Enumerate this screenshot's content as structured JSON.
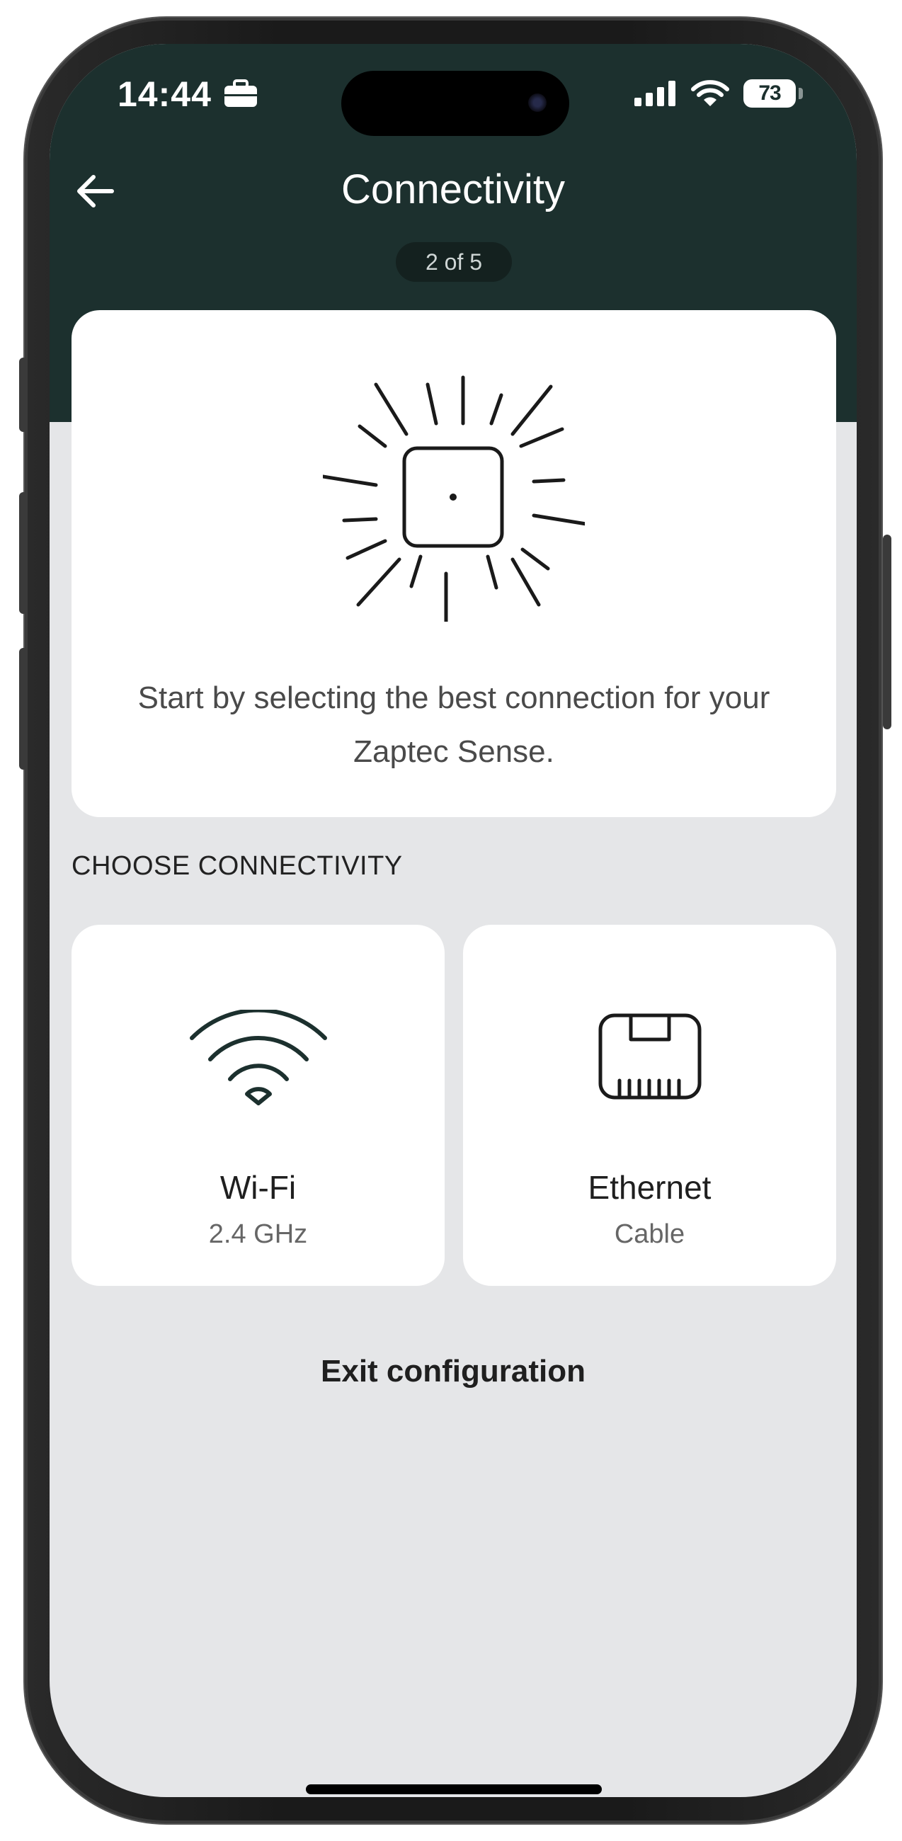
{
  "status_bar": {
    "time": "14:44",
    "battery": "73",
    "icons": [
      "briefcase-icon",
      "cellular-signal-icon",
      "wifi-icon",
      "battery-icon"
    ]
  },
  "header": {
    "title": "Connectivity",
    "step": "2 of 5",
    "back_icon": "arrow-left-icon"
  },
  "hero": {
    "illustration": "sun-burst-device-icon",
    "text": "Start by selecting the best connection for your Zaptec Sense."
  },
  "connectivity": {
    "section_label": "CHOOSE CONNECTIVITY",
    "options": [
      {
        "title": "Wi-Fi",
        "subtitle": "2.4 GHz",
        "icon": "wifi-icon"
      },
      {
        "title": "Ethernet",
        "subtitle": "Cable",
        "icon": "ethernet-port-icon"
      }
    ]
  },
  "footer": {
    "exit_label": "Exit configuration"
  },
  "colors": {
    "header_bg": "#1c302e",
    "page_bg": "#e5e6e8",
    "card_bg": "#ffffff",
    "icon_stroke": "#1c302e"
  }
}
